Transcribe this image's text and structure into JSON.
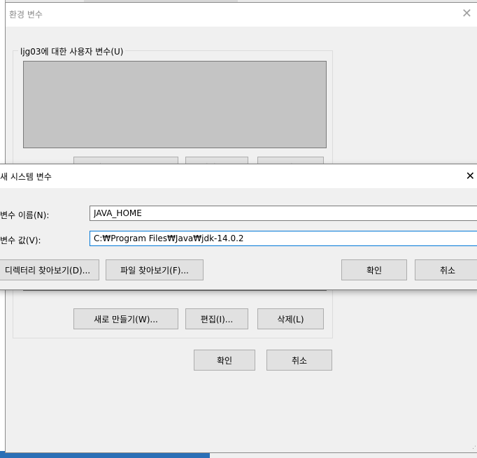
{
  "env_dialog": {
    "title": "환경 변수",
    "close_glyph": "✕",
    "user_vars_label": "ljg03에 대한 사용자 변수(U)",
    "buttons": {
      "new": "새로 만들기(W)...",
      "edit": "편집(I)...",
      "delete": "삭제(L)"
    },
    "ok": "확인",
    "cancel": "취소"
  },
  "sys_dialog": {
    "title": "새 시스템 변수",
    "close_glyph": "✕",
    "var_name_label": "변수 이름(N):",
    "var_name_value": "JAVA_HOME",
    "var_value_label": "변수 값(V):",
    "var_value_value": "C:₩Program Files₩Java₩jdk-14.0.2",
    "browse_dir": "디렉터리 찾아보기(D)...",
    "browse_file": "파일 찾아보기(F)...",
    "ok": "확인",
    "cancel": "취소"
  }
}
